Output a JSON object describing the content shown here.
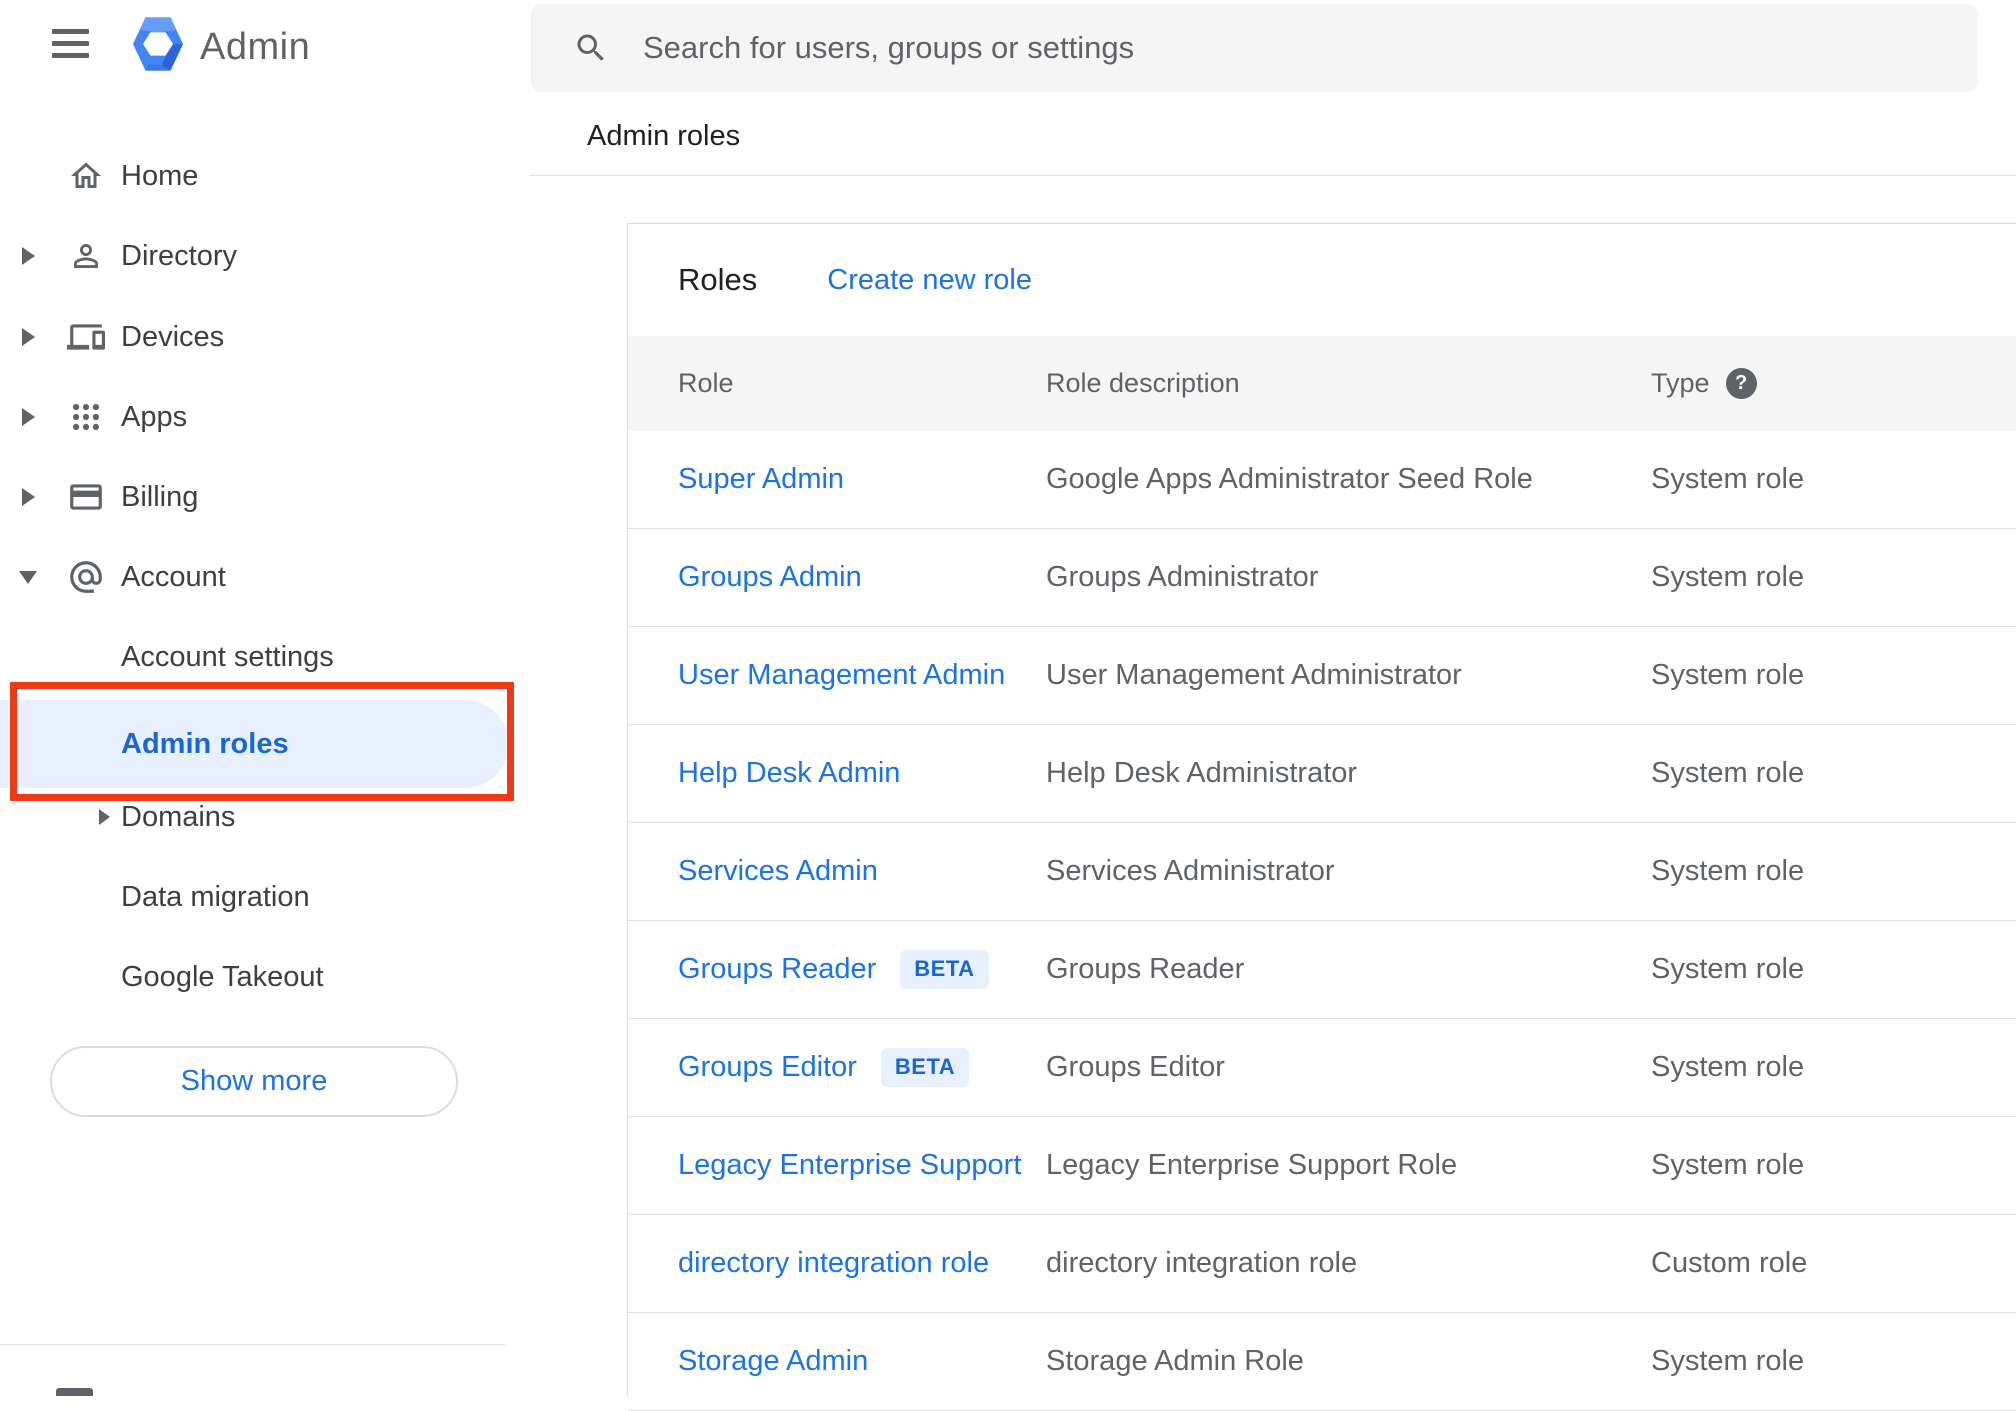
{
  "app": {
    "title": "Admin"
  },
  "search": {
    "placeholder": "Search for users, groups or settings"
  },
  "breadcrumb": "Admin roles",
  "sidebar": {
    "items": [
      {
        "label": "Home",
        "icon": "home-icon",
        "expander": "none"
      },
      {
        "label": "Directory",
        "icon": "person-icon",
        "expander": "collapsed"
      },
      {
        "label": "Devices",
        "icon": "devices-icon",
        "expander": "collapsed"
      },
      {
        "label": "Apps",
        "icon": "apps-grid-icon",
        "expander": "collapsed"
      },
      {
        "label": "Billing",
        "icon": "credit-card-icon",
        "expander": "collapsed"
      },
      {
        "label": "Account",
        "icon": "at-icon",
        "expander": "expanded"
      }
    ],
    "account_children": [
      {
        "label": "Account settings",
        "selected": false
      },
      {
        "label": "Admin roles",
        "selected": true
      },
      {
        "label": "Domains",
        "selected": false,
        "expander": "collapsed"
      },
      {
        "label": "Data migration",
        "selected": false
      },
      {
        "label": "Google Takeout",
        "selected": false
      }
    ],
    "show_more_label": "Show more"
  },
  "main": {
    "card_title": "Roles",
    "create_link": "Create new role",
    "table": {
      "columns": {
        "role": "Role",
        "description": "Role description",
        "type": "Type"
      },
      "help_icon": "?",
      "rows": [
        {
          "role": "Super Admin",
          "description": "Google Apps Administrator Seed Role",
          "type": "System role"
        },
        {
          "role": "Groups Admin",
          "description": "Groups Administrator",
          "type": "System role"
        },
        {
          "role": "User Management Admin",
          "description": "User Management Administrator",
          "type": "System role"
        },
        {
          "role": "Help Desk Admin",
          "description": "Help Desk Administrator",
          "type": "System role"
        },
        {
          "role": "Services Admin",
          "description": "Services Administrator",
          "type": "System role"
        },
        {
          "role": "Groups Reader",
          "beta": "BETA",
          "description": "Groups Reader",
          "type": "System role"
        },
        {
          "role": "Groups Editor",
          "beta": "BETA",
          "description": "Groups Editor",
          "type": "System role"
        },
        {
          "role": "Legacy Enterprise Support",
          "description": "Legacy Enterprise Support Role",
          "type": "System role"
        },
        {
          "role": "directory integration role",
          "description": "directory integration role",
          "type": "Custom role"
        },
        {
          "role": "Storage Admin",
          "description": "Storage Admin Role",
          "type": "System role"
        }
      ]
    }
  },
  "colors": {
    "link_blue": "#1a73e8",
    "selected_blue": "#1967d2",
    "selected_bg": "#e8effd",
    "beta_bg": "#e8f0fe",
    "annotation_red": "#ee3b17",
    "table_header_bg": "#f5f5f5",
    "icon_gray": "#5f6368"
  }
}
